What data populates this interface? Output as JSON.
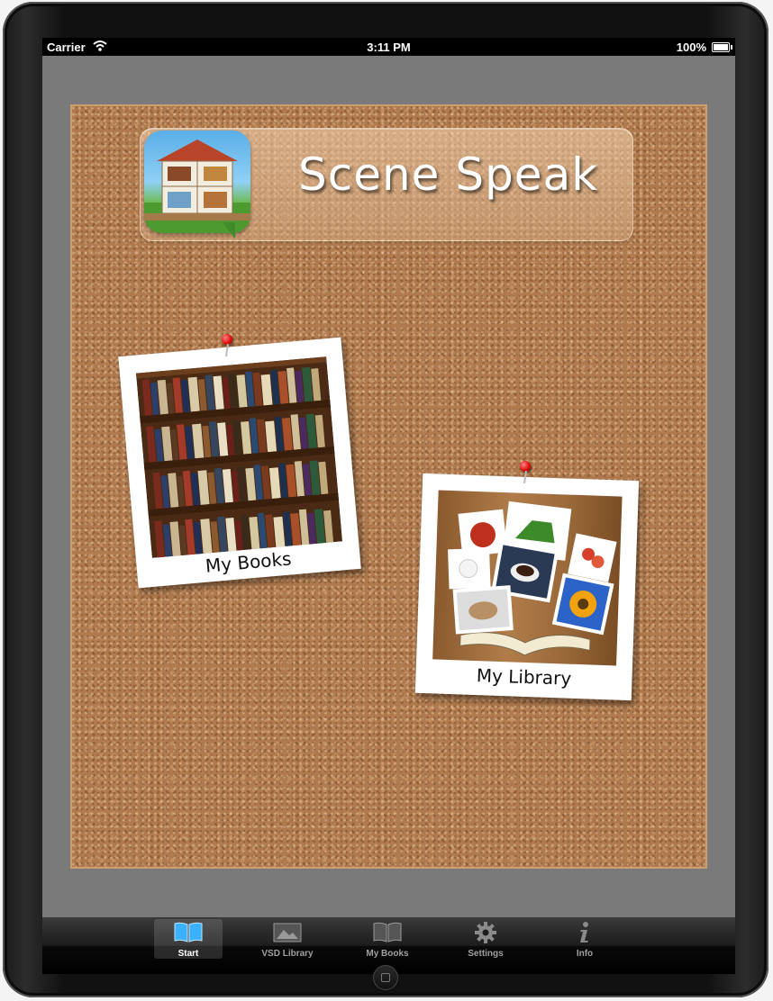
{
  "status_bar": {
    "carrier": "Carrier",
    "time": "3:11 PM",
    "battery": "100%"
  },
  "app": {
    "title": "Scene Speak"
  },
  "cards": {
    "my_books": "My Books",
    "my_library": "My Library"
  },
  "tab_bar": {
    "selected": "Start",
    "tabs": [
      {
        "label": "Start",
        "icon": "open-book-icon"
      },
      {
        "label": "VSD Library",
        "icon": "picture-frame-icon"
      },
      {
        "label": "My Books",
        "icon": "book-icon"
      },
      {
        "label": "Settings",
        "icon": "gear-icon"
      },
      {
        "label": "Info",
        "icon": "info-icon"
      }
    ]
  },
  "colors": {
    "cork": "#b07a4e",
    "screen_background": "#7a7a7a",
    "tab_active_icon": "#3bb0ff",
    "pin": "#dd1111"
  }
}
